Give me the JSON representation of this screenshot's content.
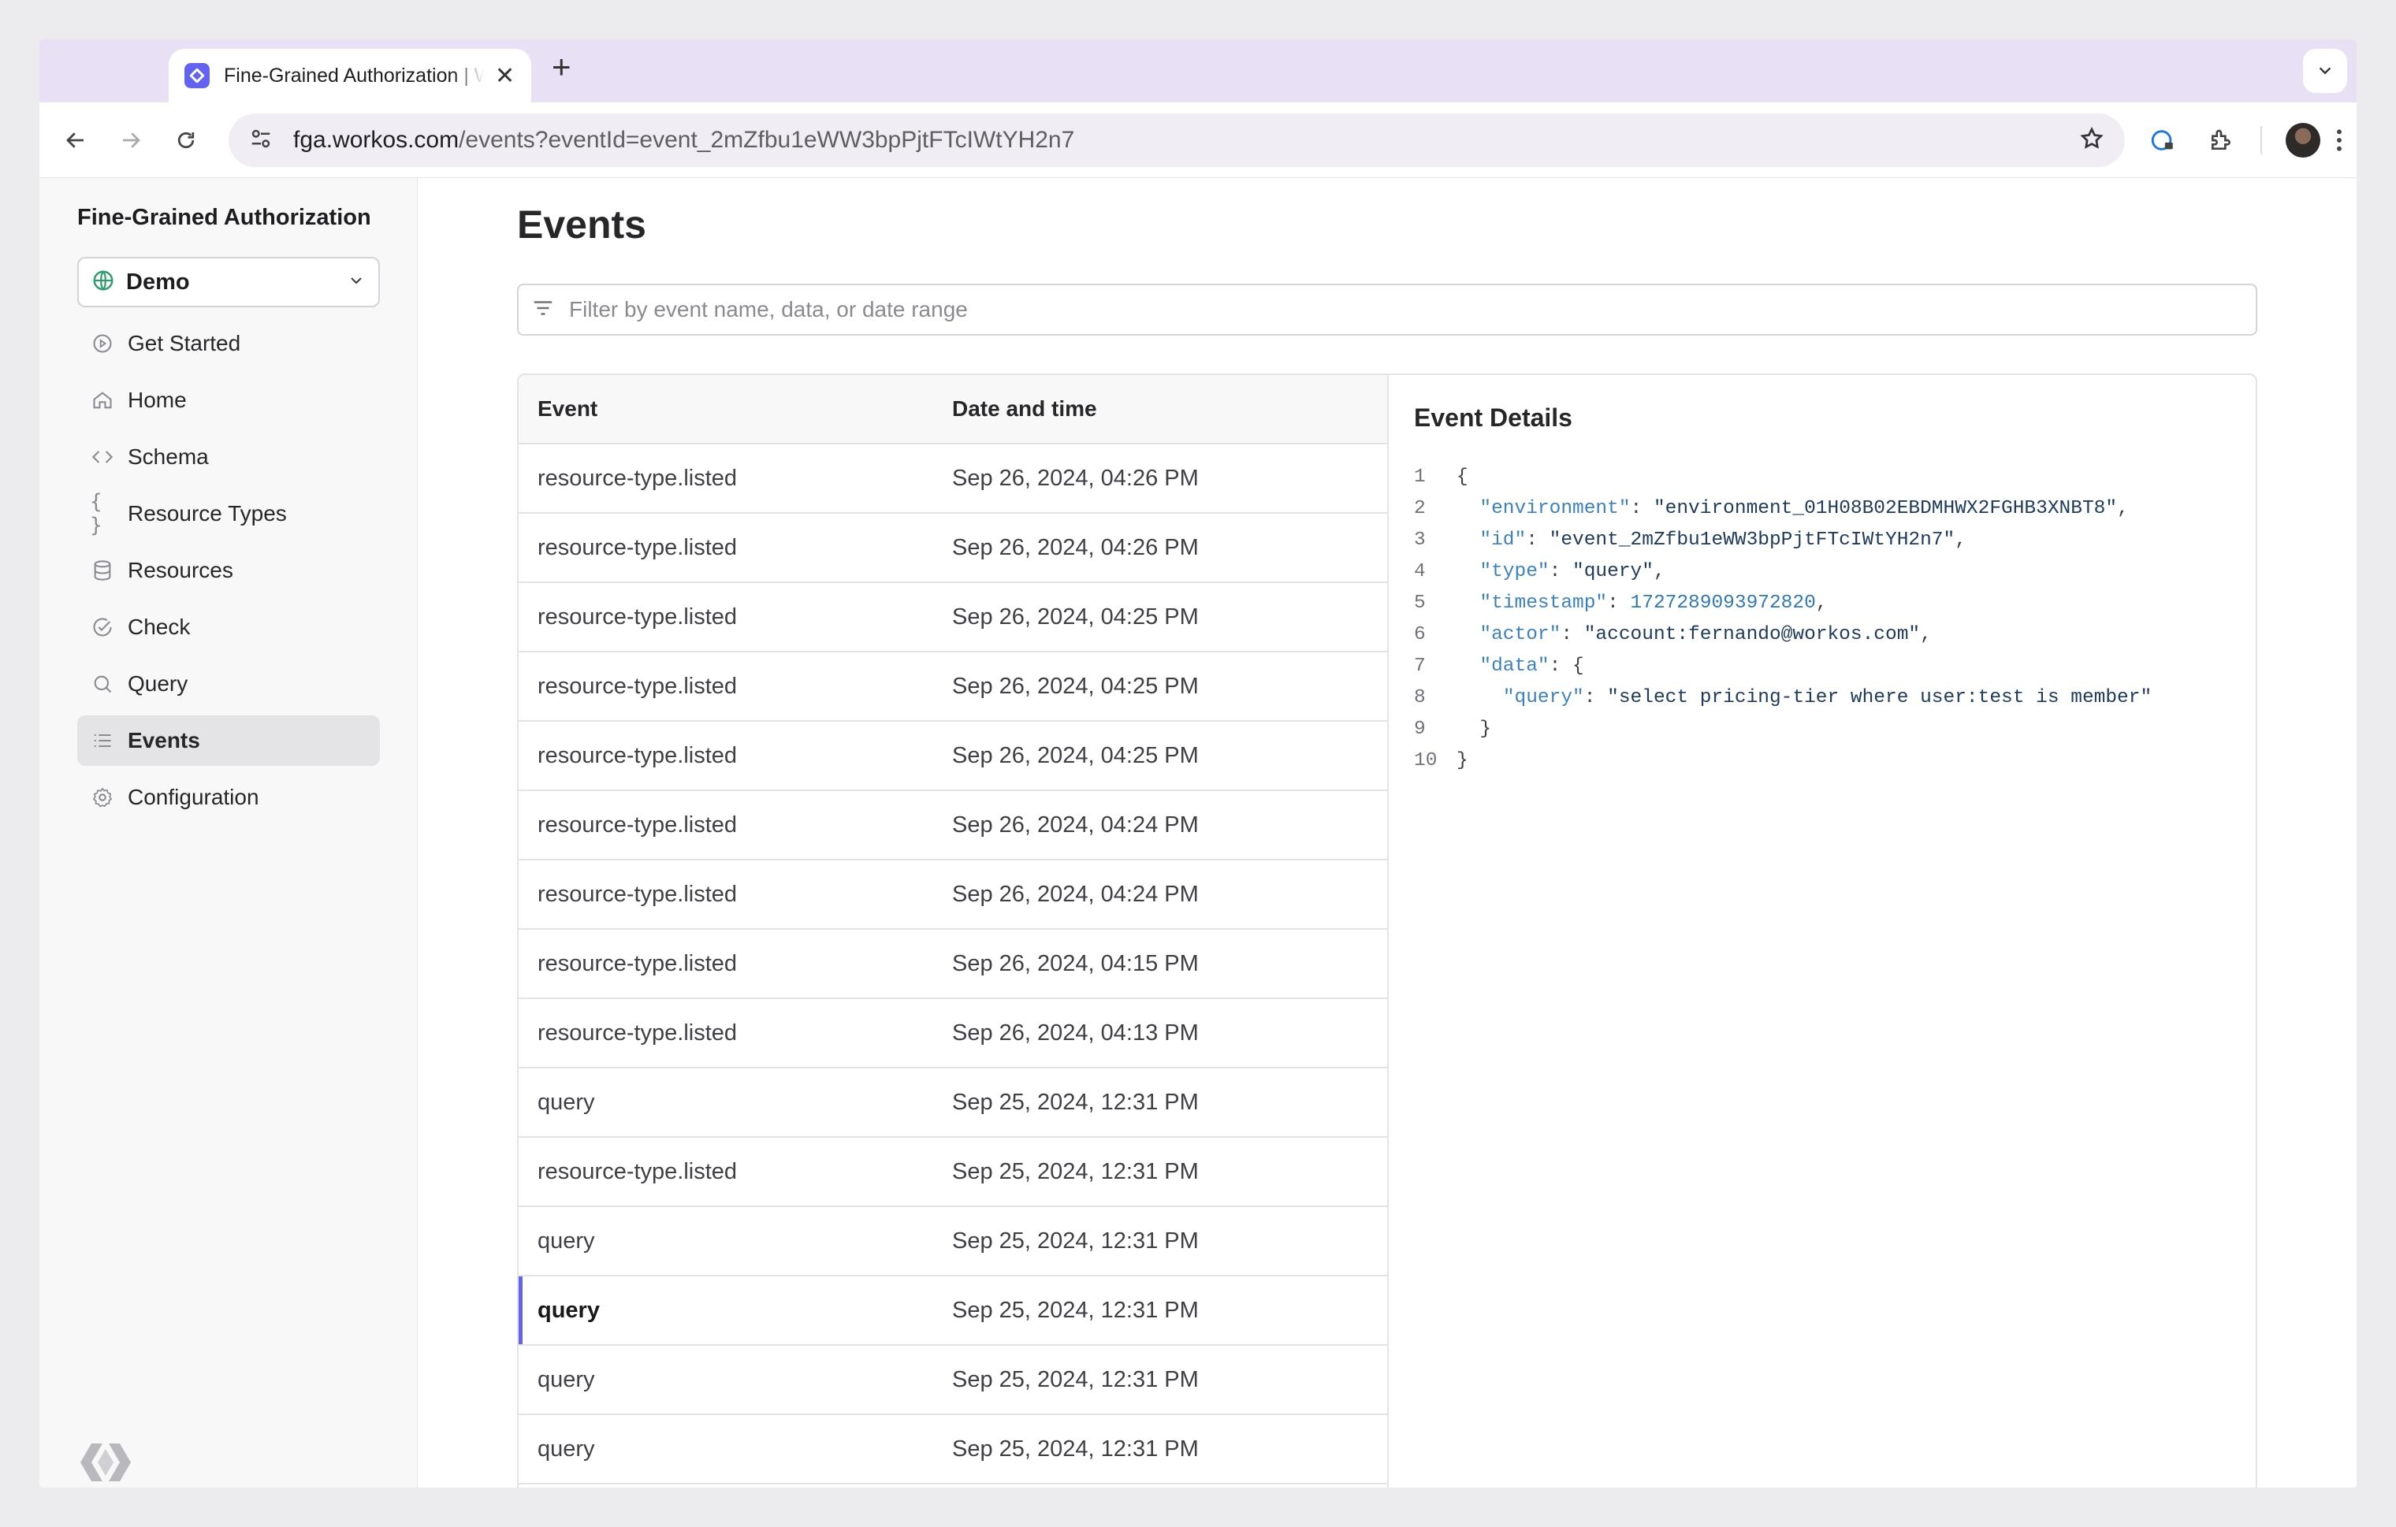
{
  "browser": {
    "tab_title": "Fine-Grained Authorization | WorkOS",
    "url_host": "fga.workos.com",
    "url_path": "/events?eventId=event_2mZfbu1eWW3bpPjtFTcIWtYH2n7"
  },
  "sidebar": {
    "app_title": "Fine-Grained Authorization",
    "environment": "Demo",
    "items": [
      {
        "label": "Get Started",
        "icon": "play-circle-icon"
      },
      {
        "label": "Home",
        "icon": "home-icon"
      },
      {
        "label": "Schema",
        "icon": "code-icon"
      },
      {
        "label": "Resource Types",
        "icon": "braces-icon"
      },
      {
        "label": "Resources",
        "icon": "database-icon"
      },
      {
        "label": "Check",
        "icon": "check-circle-icon"
      },
      {
        "label": "Query",
        "icon": "search-icon"
      },
      {
        "label": "Events",
        "icon": "list-icon"
      },
      {
        "label": "Configuration",
        "icon": "gear-icon"
      }
    ],
    "active_item": "Events"
  },
  "main": {
    "title": "Events",
    "filter_placeholder": "Filter by event name, data, or date range",
    "columns": [
      "Event",
      "Date and time"
    ],
    "rows": [
      {
        "event": "resource-type.listed",
        "datetime": "Sep 26, 2024, 04:26 PM"
      },
      {
        "event": "resource-type.listed",
        "datetime": "Sep 26, 2024, 04:26 PM"
      },
      {
        "event": "resource-type.listed",
        "datetime": "Sep 26, 2024, 04:25 PM"
      },
      {
        "event": "resource-type.listed",
        "datetime": "Sep 26, 2024, 04:25 PM"
      },
      {
        "event": "resource-type.listed",
        "datetime": "Sep 26, 2024, 04:25 PM"
      },
      {
        "event": "resource-type.listed",
        "datetime": "Sep 26, 2024, 04:24 PM"
      },
      {
        "event": "resource-type.listed",
        "datetime": "Sep 26, 2024, 04:24 PM"
      },
      {
        "event": "resource-type.listed",
        "datetime": "Sep 26, 2024, 04:15 PM"
      },
      {
        "event": "resource-type.listed",
        "datetime": "Sep 26, 2024, 04:13 PM"
      },
      {
        "event": "query",
        "datetime": "Sep 25, 2024, 12:31 PM"
      },
      {
        "event": "resource-type.listed",
        "datetime": "Sep 25, 2024, 12:31 PM"
      },
      {
        "event": "query",
        "datetime": "Sep 25, 2024, 12:31 PM"
      },
      {
        "event": "query",
        "datetime": "Sep 25, 2024, 12:31 PM",
        "selected": true
      },
      {
        "event": "query",
        "datetime": "Sep 25, 2024, 12:31 PM"
      },
      {
        "event": "query",
        "datetime": "Sep 25, 2024, 12:31 PM"
      }
    ]
  },
  "details": {
    "title": "Event Details",
    "json_lines": [
      {
        "n": "1",
        "parts": [
          [
            "p",
            "{"
          ]
        ]
      },
      {
        "n": "2",
        "parts": [
          [
            "p",
            "  "
          ],
          [
            "k",
            "\"environment\""
          ],
          [
            "p",
            ": "
          ],
          [
            "s",
            "\"environment_01H08B02EBDMHWX2FGHB3XNBT8\""
          ],
          [
            "p",
            ","
          ]
        ]
      },
      {
        "n": "3",
        "parts": [
          [
            "p",
            "  "
          ],
          [
            "k",
            "\"id\""
          ],
          [
            "p",
            ": "
          ],
          [
            "s",
            "\"event_2mZfbu1eWW3bpPjtFTcIWtYH2n7\""
          ],
          [
            "p",
            ","
          ]
        ]
      },
      {
        "n": "4",
        "parts": [
          [
            "p",
            "  "
          ],
          [
            "k",
            "\"type\""
          ],
          [
            "p",
            ": "
          ],
          [
            "s",
            "\"query\""
          ],
          [
            "p",
            ","
          ]
        ]
      },
      {
        "n": "5",
        "parts": [
          [
            "p",
            "  "
          ],
          [
            "k",
            "\"timestamp\""
          ],
          [
            "p",
            ": "
          ],
          [
            "n",
            "1727289093972820"
          ],
          [
            "p",
            ","
          ]
        ]
      },
      {
        "n": "6",
        "parts": [
          [
            "p",
            "  "
          ],
          [
            "k",
            "\"actor\""
          ],
          [
            "p",
            ": "
          ],
          [
            "s",
            "\"account:fernando@workos.com\""
          ],
          [
            "p",
            ","
          ]
        ]
      },
      {
        "n": "7",
        "parts": [
          [
            "p",
            "  "
          ],
          [
            "k",
            "\"data\""
          ],
          [
            "p",
            ": {"
          ]
        ]
      },
      {
        "n": "8",
        "parts": [
          [
            "p",
            "    "
          ],
          [
            "k",
            "\"query\""
          ],
          [
            "p",
            ": "
          ],
          [
            "s",
            "\"select pricing-tier where user:test is member\""
          ]
        ]
      },
      {
        "n": "9",
        "parts": [
          [
            "p",
            "  }"
          ]
        ]
      },
      {
        "n": "10",
        "parts": [
          [
            "p",
            "}"
          ]
        ]
      }
    ]
  },
  "colors": {
    "accent": "#6363f1",
    "sidebar_bg": "#f8f8f9",
    "tab_strip": "#e8e0f4"
  }
}
